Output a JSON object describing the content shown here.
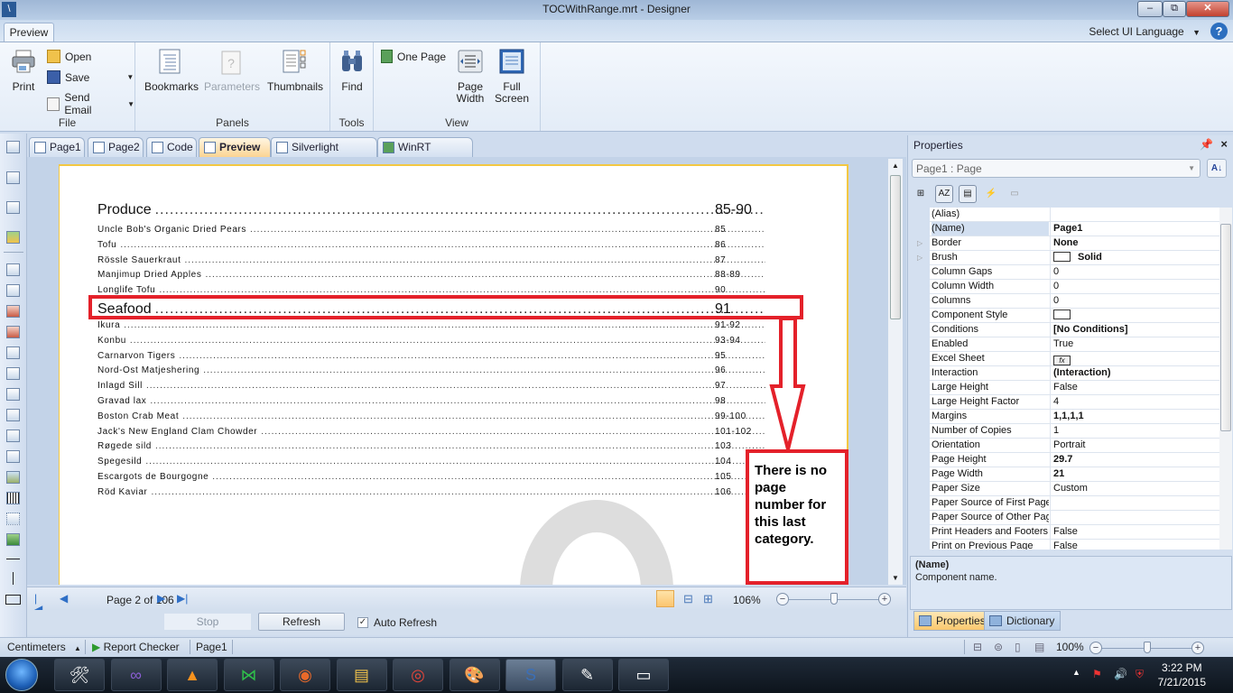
{
  "window": {
    "title": "TOCWithRange.mrt - Designer",
    "app_icon": "stimulsoft-icon",
    "controls": {
      "minimize": "–",
      "maximize": "⧉",
      "close": "✕"
    }
  },
  "ribbon": {
    "tab": "Preview",
    "ui_language": "Select UI Language",
    "help": "?",
    "groups": {
      "file": {
        "label": "File",
        "print": "Print",
        "open": "Open",
        "save": "Save",
        "send_email": "Send Email"
      },
      "panels": {
        "label": "Panels",
        "bookmarks": "Bookmarks",
        "parameters": "Parameters",
        "thumbnails": "Thumbnails"
      },
      "tools": {
        "label": "Tools",
        "find": "Find"
      },
      "view": {
        "label": "View",
        "one_page": "One Page",
        "page_width_1": "Page",
        "page_width_2": "Width",
        "full_screen_1": "Full",
        "full_screen_2": "Screen"
      }
    }
  },
  "doc_tabs": [
    {
      "label": "Page1",
      "active": false
    },
    {
      "label": "Page2",
      "active": false
    },
    {
      "label": "Code",
      "active": false
    },
    {
      "label": "Preview",
      "active": true
    },
    {
      "label": "Silverlight Preview",
      "active": false
    },
    {
      "label": "WinRT Preview",
      "active": false
    }
  ],
  "toc": {
    "categories": [
      {
        "name": "Produce",
        "pages": "85-90",
        "items": [
          {
            "name": "Uncle Bob's Organic Dried Pears",
            "pages": "85"
          },
          {
            "name": "Tofu",
            "pages": "86"
          },
          {
            "name": "Rössle Sauerkraut",
            "pages": "87"
          },
          {
            "name": "Manjimup Dried Apples",
            "pages": "88-89"
          },
          {
            "name": "Longlife Tofu",
            "pages": "90"
          }
        ]
      },
      {
        "name": "Seafood",
        "pages": "91",
        "items": [
          {
            "name": "Ikura",
            "pages": "91-92"
          },
          {
            "name": "Konbu",
            "pages": "93-94"
          },
          {
            "name": "Carnarvon Tigers",
            "pages": "95"
          },
          {
            "name": "Nord-Ost Matjeshering",
            "pages": "96"
          },
          {
            "name": "Inlagd Sill",
            "pages": "97"
          },
          {
            "name": "Gravad lax",
            "pages": "98"
          },
          {
            "name": "Boston Crab Meat",
            "pages": "99-100"
          },
          {
            "name": "Jack's New England Clam Chowder",
            "pages": "101-102"
          },
          {
            "name": "Røgede sild",
            "pages": "103"
          },
          {
            "name": "Spegesild",
            "pages": "104"
          },
          {
            "name": "Escargots de Bourgogne",
            "pages": "105"
          },
          {
            "name": "Röd Kaviar",
            "pages": "106"
          }
        ]
      }
    ]
  },
  "annotation": {
    "note": "There is no page number for this last category.",
    "color": "#e4212a"
  },
  "nav": {
    "page_info": "Page 2 of 106",
    "zoom": "106%",
    "zoom_fraction": 0.5
  },
  "refresh_bar": {
    "stop": "Stop",
    "refresh": "Refresh",
    "auto_refresh": "Auto Refresh",
    "auto_refresh_checked": true
  },
  "properties": {
    "title": "Properties",
    "selected_object": "Page1 : Page",
    "rows": [
      {
        "key": "(Alias)",
        "value": "",
        "bold": false
      },
      {
        "key": "(Name)",
        "value": "Page1",
        "bold": true,
        "selected": true
      },
      {
        "key": "Border",
        "value": "None",
        "bold": true,
        "expandable": true
      },
      {
        "key": "Brush",
        "value": "Solid",
        "bold": true,
        "expandable": true,
        "swatch": true
      },
      {
        "key": "Column Gaps",
        "value": "0"
      },
      {
        "key": "Column Width",
        "value": "0"
      },
      {
        "key": "Columns",
        "value": "0"
      },
      {
        "key": "Component Style",
        "value": "",
        "swatch": true
      },
      {
        "key": "Conditions",
        "value": "[No Conditions]",
        "bold": true
      },
      {
        "key": "Enabled",
        "value": "True"
      },
      {
        "key": "Excel Sheet",
        "value": "fx",
        "button": true
      },
      {
        "key": "Interaction",
        "value": "(Interaction)",
        "bold": true
      },
      {
        "key": "Large Height",
        "value": "False"
      },
      {
        "key": "Large Height Factor",
        "value": "4"
      },
      {
        "key": "Margins",
        "value": "1,1,1,1",
        "bold": true
      },
      {
        "key": "Number of Copies",
        "value": "1"
      },
      {
        "key": "Orientation",
        "value": "Portrait"
      },
      {
        "key": "Page Height",
        "value": "29.7",
        "bold": true
      },
      {
        "key": "Page Width",
        "value": "21",
        "bold": true
      },
      {
        "key": "Paper Size",
        "value": "Custom"
      },
      {
        "key": "Paper Source of First Page",
        "value": ""
      },
      {
        "key": "Paper Source of Other Pages",
        "value": ""
      },
      {
        "key": "Print Headers and Footers",
        "value": "False"
      },
      {
        "key": "Print on Previous Page",
        "value": "False"
      }
    ],
    "description_title": "(Name)",
    "description_text": "Component name.",
    "tabs": {
      "properties": "Properties",
      "dictionary": "Dictionary"
    }
  },
  "statusbar": {
    "units": "Centimeters",
    "report_checker": "Report Checker",
    "page": "Page1",
    "zoom": "100%",
    "zoom_fraction": 0.5
  },
  "taskbar": {
    "apps": [
      "tools-icon",
      "visual-studio-icon",
      "vlc-icon",
      "vs-installer-icon",
      "firefox-icon",
      "explorer-icon",
      "chrome-icon",
      "paint-icon",
      "stimulsoft-icon",
      "notepad-icon",
      "remote-desktop-icon"
    ],
    "time": "3:22 PM",
    "date": "7/21/2015"
  }
}
